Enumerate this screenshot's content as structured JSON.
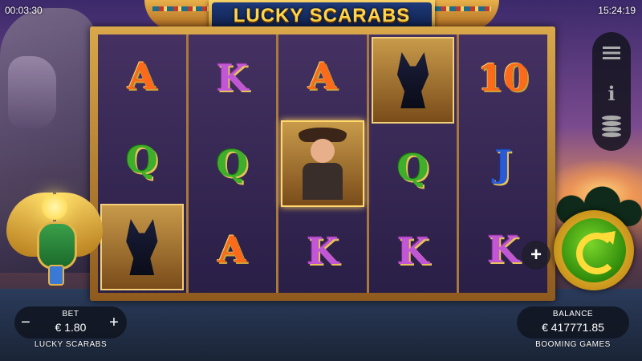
{
  "status": {
    "session_time": "00:03:30",
    "clock": "15:24:19"
  },
  "game": {
    "title": "LUCKY SCARABS",
    "name": "LUCKY SCARABS",
    "studio": "BOOMING GAMES"
  },
  "reels": [
    [
      "A",
      "Q",
      "Anubis"
    ],
    [
      "K",
      "Q",
      "A"
    ],
    [
      "A",
      "Explorer",
      "K"
    ],
    [
      "Anubis",
      "Q",
      "K"
    ],
    [
      "10",
      "J",
      "K"
    ]
  ],
  "bet": {
    "label": "BET",
    "value": "€ 1.80",
    "minus": "−",
    "plus": "+"
  },
  "balance": {
    "label": "BALANCE",
    "value": "€ 417771.85"
  },
  "controls": {
    "plus": "+",
    "info": "i"
  },
  "colors": {
    "spin_green": "#3fae2a",
    "title_gold": "#ffd54a",
    "banner_blue": "#1e3a7a"
  }
}
